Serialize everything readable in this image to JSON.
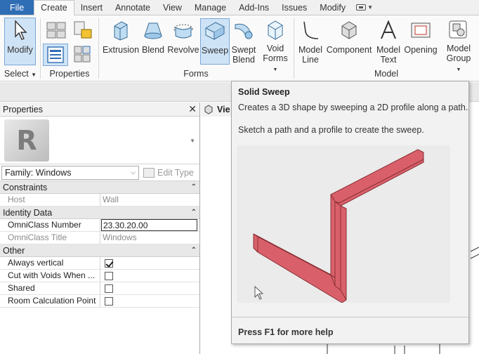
{
  "tabs": [
    {
      "label": "File"
    },
    {
      "label": "Create"
    },
    {
      "label": "Insert"
    },
    {
      "label": "Annotate"
    },
    {
      "label": "View"
    },
    {
      "label": "Manage"
    },
    {
      "label": "Add-Ins"
    },
    {
      "label": "Issues"
    },
    {
      "label": "Modify"
    }
  ],
  "ribbon": {
    "select": {
      "modify_label": "Modify",
      "panel_label": "Select"
    },
    "properties_panel_label": "Properties",
    "forms": {
      "panel_label": "Forms",
      "extrusion": "Extrusion",
      "blend": "Blend",
      "revolve": "Revolve",
      "sweep": "Sweep",
      "swept_blend_1": "Swept",
      "swept_blend_2": "Blend",
      "void_forms_1": "Void",
      "void_forms_2": "Forms"
    },
    "model": {
      "panel_label": "Model",
      "model_line_1": "Model",
      "model_line_2": "Line",
      "component": "Component",
      "model_text_1": "Model",
      "model_text_2": "Text",
      "opening": "Opening",
      "model_group_1": "Model",
      "model_group_2": "Group"
    }
  },
  "properties": {
    "title": "Properties",
    "family_label": "Family: Windows",
    "edit_type": "Edit Type",
    "sections": {
      "constraints": "Constraints",
      "identity": "Identity Data",
      "other": "Other"
    },
    "rows": {
      "host_k": "Host",
      "host_v": "Wall",
      "omni_num_k": "OmniClass Number",
      "omni_num_v": "23.30.20.00",
      "omni_title_k": "OmniClass Title",
      "omni_title_v": "Windows",
      "always_vertical_k": "Always vertical",
      "cut_voids_k": "Cut with Voids When ...",
      "shared_k": "Shared",
      "room_calc_k": "Room Calculation Point"
    },
    "checkboxes": {
      "always_vertical": true,
      "cut_voids": false,
      "shared": false,
      "room_calc": false
    }
  },
  "view": {
    "tab_label": "Vie"
  },
  "tooltip": {
    "title": "Solid Sweep",
    "line1": "Creates a 3D shape by sweeping a 2D profile along a path.",
    "line2": "Sketch a path and a profile to create the sweep.",
    "help": "Press F1 for more help",
    "shape_color": "#d9606a"
  }
}
